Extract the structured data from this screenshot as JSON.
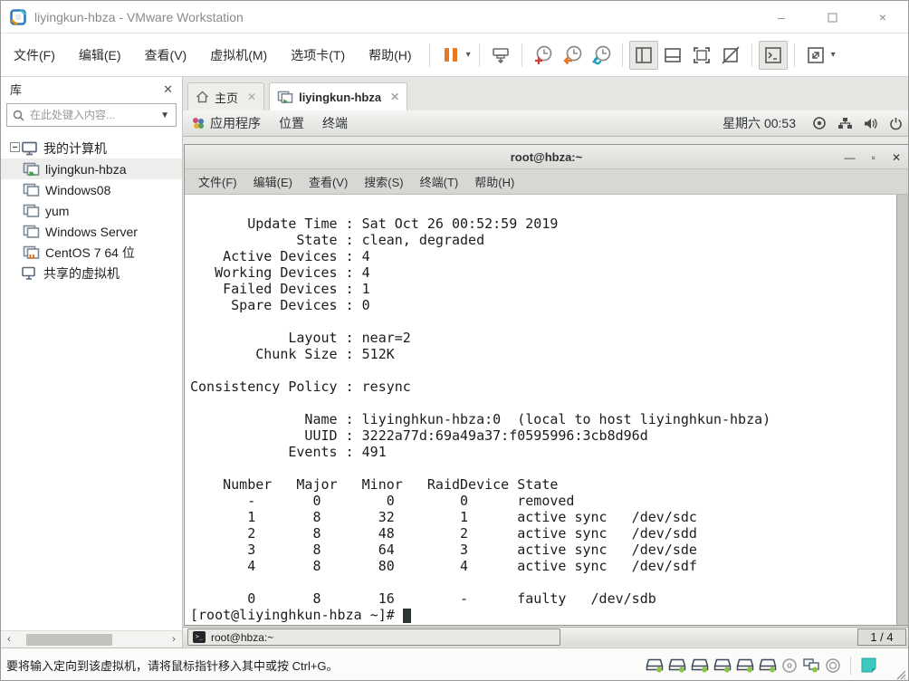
{
  "window": {
    "title": "liyingkun-hbza - VMware Workstation",
    "controls": {
      "minimize": "–",
      "close": "×"
    }
  },
  "menubar": {
    "items": [
      "文件(F)",
      "编辑(E)",
      "查看(V)",
      "虚拟机(M)",
      "选项卡(T)",
      "帮助(H)"
    ]
  },
  "toolbar": {
    "buttons": [
      "pause",
      "send-ctrl-alt-del",
      "take-snapshot",
      "revert-snapshot",
      "snapshot-manager",
      "show-library",
      "show-thumbnail-bar",
      "full-screen",
      "unity-mode",
      "console-view",
      "stretch-guest"
    ]
  },
  "tabs": {
    "home": "主页",
    "vm": "liyingkun-hbza"
  },
  "sidebar": {
    "title": "库",
    "search_placeholder": "在此处键入内容...",
    "tree": {
      "root": "我的计算机",
      "items": [
        "liyingkun-hbza",
        "Windows08",
        "yum",
        "Windows Server",
        "CentOS 7 64 位"
      ],
      "shared": "共享的虚拟机"
    }
  },
  "guest": {
    "panel": {
      "menus": [
        "应用程序",
        "位置",
        "终端"
      ],
      "clock": "星期六 00:53",
      "tray_icons": [
        "screenshot",
        "network",
        "volume",
        "power"
      ]
    },
    "terminal": {
      "title": "root@hbza:~",
      "menus": [
        "文件(F)",
        "编辑(E)",
        "查看(V)",
        "搜索(S)",
        "终端(T)",
        "帮助(H)"
      ],
      "output": [
        "",
        "       Update Time : Sat Oct 26 00:52:59 2019",
        "             State : clean, degraded",
        "    Active Devices : 4",
        "   Working Devices : 4",
        "    Failed Devices : 1",
        "     Spare Devices : 0",
        "",
        "            Layout : near=2",
        "        Chunk Size : 512K",
        "",
        "Consistency Policy : resync",
        "",
        "              Name : liyinghkun-hbza:0  (local to host liyinghkun-hbza)",
        "              UUID : 3222a77d:69a49a37:f0595996:3cb8d96d",
        "            Events : 491",
        "",
        "    Number   Major   Minor   RaidDevice State",
        "       -       0        0        0      removed",
        "       1       8       32        1      active sync   /dev/sdc",
        "       2       8       48        2      active sync   /dev/sdd",
        "       3       8       64        3      active sync   /dev/sde",
        "       4       8       80        4      active sync   /dev/sdf",
        "",
        "       0       8       16        -      faulty   /dev/sdb"
      ],
      "prompt": "[root@liyinghkun-hbza ~]# "
    },
    "taskbar": {
      "window_button": "root@hbza:~",
      "workspace_pager": "1 / 4"
    }
  },
  "statusbar": {
    "message": "要将输入定向到该虚拟机，请将鼠标指针移入其中或按 Ctrl+G。",
    "devices": [
      "hard-disk",
      "hard-disk",
      "hard-disk",
      "hard-disk",
      "hard-disk",
      "hard-disk",
      "cd-rom",
      "network-adapter",
      "sound",
      "message-log"
    ]
  },
  "colors": {
    "accent_orange": "#e87722",
    "snapshot_blue": "#1ba0c4",
    "running_green": "#43a047",
    "status_green": "#8bc34a",
    "note_teal": "#3fc8c0"
  }
}
